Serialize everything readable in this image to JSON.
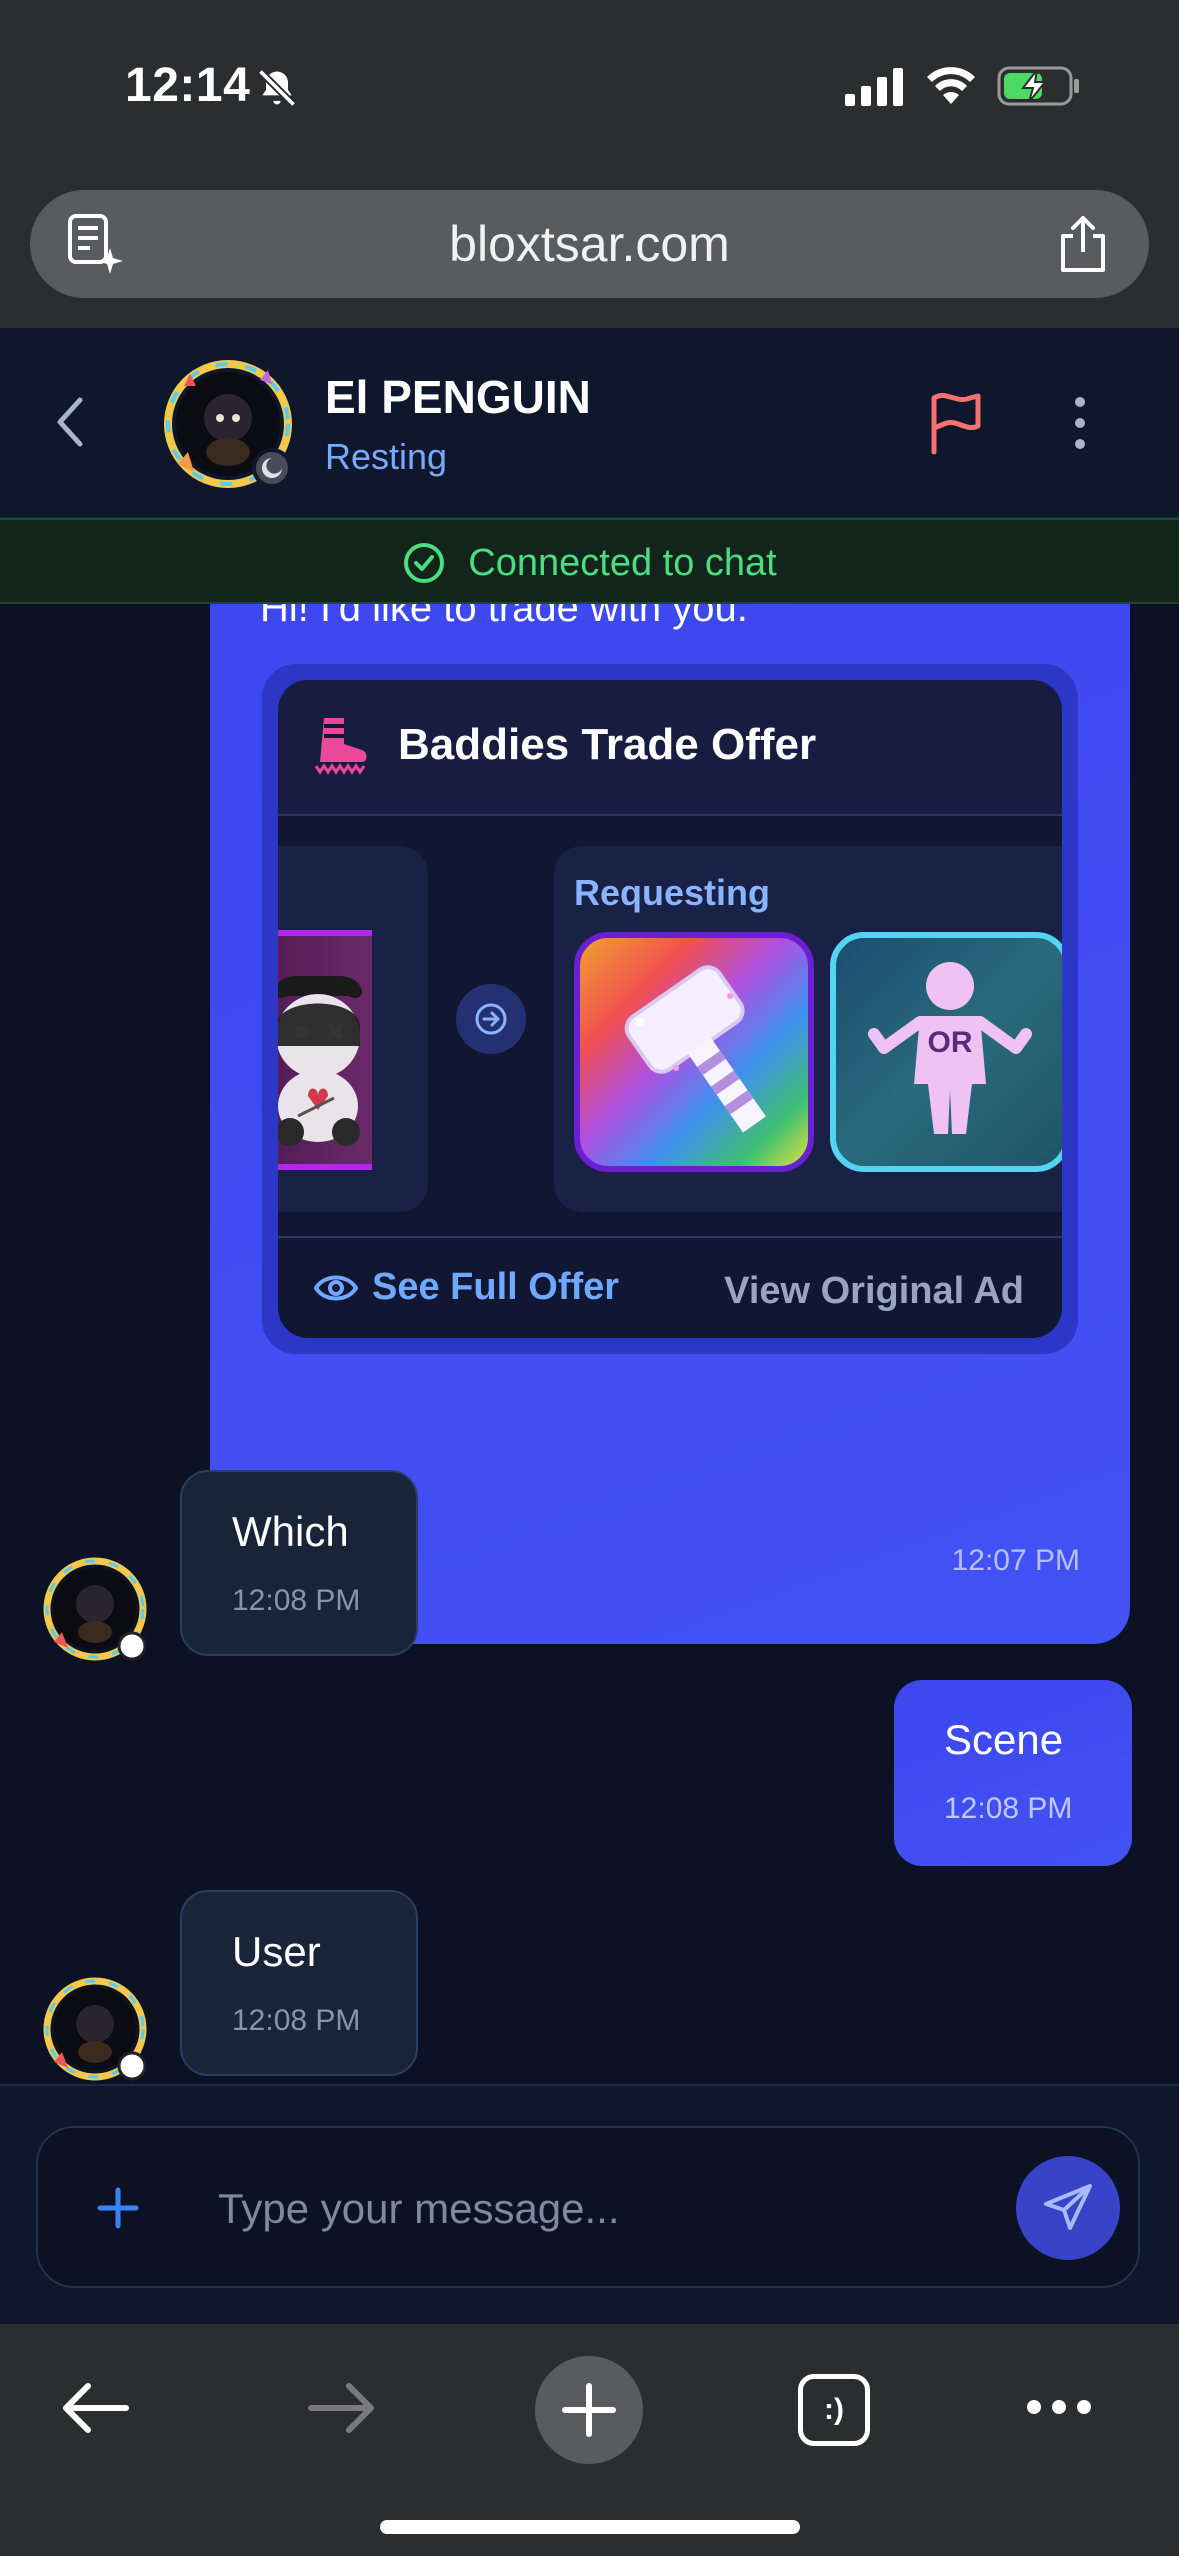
{
  "status_bar": {
    "time": "12:14"
  },
  "browser": {
    "url": "bloxtsar.com",
    "tabs_label": ":)"
  },
  "chat": {
    "contact_name": "El PENGUIN",
    "contact_status": "Resting",
    "connection_text": "Connected to chat"
  },
  "offer_message": {
    "text": "Hi! I'd like to trade with you.",
    "card_title": "Baddies Trade Offer",
    "requesting_label": "Requesting",
    "item_or_label": "OR",
    "see_full_label": "See Full Offer",
    "view_original_label": "View Original Ad",
    "time": "12:07 PM"
  },
  "messages": [
    {
      "direction": "in",
      "text": "Which",
      "time": "12:08 PM"
    },
    {
      "direction": "out",
      "text": "Scene",
      "time": "12:08 PM"
    },
    {
      "direction": "in",
      "text": "User",
      "time": "12:08 PM"
    }
  ],
  "composer": {
    "placeholder": "Type your message..."
  },
  "colors": {
    "accent_blue": "#3e4cf0",
    "connected_green": "#4ade80",
    "flag_red": "#f87171",
    "background": "#0c1223"
  }
}
